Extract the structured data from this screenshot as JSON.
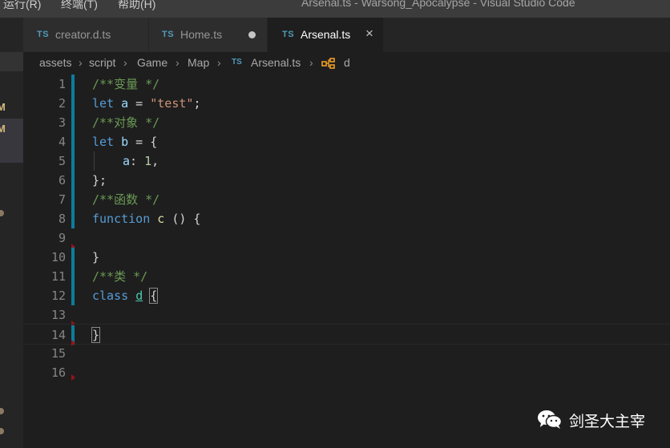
{
  "menu": {
    "items": [
      {
        "label": "运行(R)"
      },
      {
        "label": "终端(T)"
      },
      {
        "label": "帮助(H)"
      }
    ]
  },
  "window": {
    "title": "Arsenal.ts - Warsong_Apocalypse - Visual Studio Code"
  },
  "sidebar": {
    "badges": [
      "M",
      "M"
    ]
  },
  "tabs": [
    {
      "icon": "TS",
      "label": "creator.d.ts",
      "state": "clean"
    },
    {
      "icon": "TS",
      "label": "Home.ts",
      "state": "modified"
    },
    {
      "icon": "TS",
      "label": "Arsenal.ts",
      "state": "active"
    }
  ],
  "tab_close_glyph": "×",
  "breadcrumb": {
    "items": [
      "assets",
      "script",
      "Game",
      "Map"
    ],
    "file_icon": "TS",
    "file": "Arsenal.ts",
    "symbol": "d"
  },
  "editor": {
    "line_numbers": [
      "1",
      "2",
      "3",
      "4",
      "5",
      "6",
      "7",
      "8",
      "9",
      "10",
      "11",
      "12",
      "13",
      "14",
      "15",
      "16"
    ],
    "lines": {
      "l1": {
        "comment": "/**变量 */"
      },
      "l2": {
        "kw": "let",
        "name": "a",
        "op": " = ",
        "str": "\"test\"",
        "end": ";"
      },
      "l3": {
        "comment": "/**对象 */"
      },
      "l4": {
        "kw": "let",
        "name": "b",
        "op": " = {"
      },
      "l5": {
        "prop": "a",
        "sep": ": ",
        "num": "1",
        "end": ","
      },
      "l6": {
        "text": "};"
      },
      "l7": {
        "comment": "/**函数 */"
      },
      "l8": {
        "kw": "function",
        "name": "c",
        "rest": " () {"
      },
      "l10": {
        "text": "}"
      },
      "l11": {
        "comment": "/**类 */"
      },
      "l12": {
        "kw": "class",
        "name": "d",
        "brace": "{"
      },
      "l14": {
        "text": "}"
      }
    }
  },
  "watermark": {
    "text": "剑圣大主宰"
  },
  "colors": {
    "background": "#1e1e1e",
    "gutter_modified": "#0c7d9d",
    "gutter_deleted": "#94151b",
    "keyword": "#569cd6",
    "comment": "#6a9955",
    "string": "#ce9178"
  }
}
